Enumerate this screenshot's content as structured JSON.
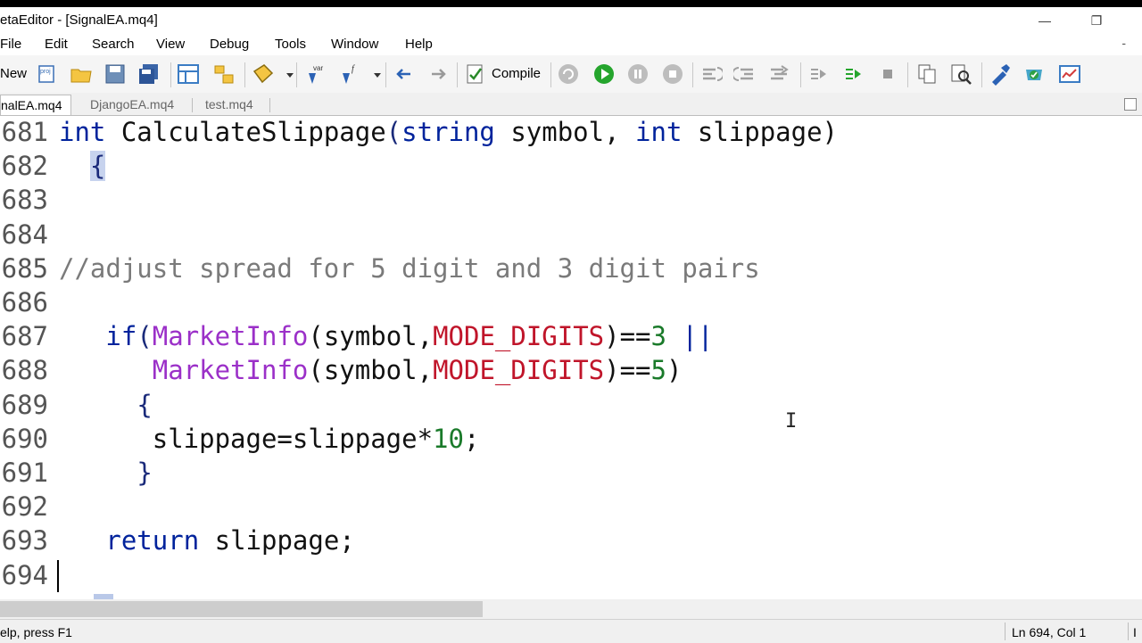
{
  "window": {
    "title": "etaEditor - [SignalEA.mq4]"
  },
  "menu": [
    "File",
    "Edit",
    "Search",
    "View",
    "Debug",
    "Tools",
    "Window",
    "Help"
  ],
  "toolbar": {
    "new_label": "New",
    "compile_label": "Compile",
    "var_label": "var"
  },
  "tabs": [
    "nalEA.mq4",
    "DjangoEA.mq4",
    "test.mq4"
  ],
  "editor": {
    "lines": [
      {
        "n": "681",
        "tokens": [
          {
            "t": "int ",
            "c": "kw"
          },
          {
            "t": "CalculateSlippage",
            "c": "fn"
          },
          {
            "t": "(",
            "c": "bk"
          },
          {
            "t": "string ",
            "c": "kw"
          },
          {
            "t": "symbol, ",
            "c": "fn"
          },
          {
            "t": "int ",
            "c": "kw"
          },
          {
            "t": "slippage)",
            "c": "fn"
          }
        ]
      },
      {
        "n": "682",
        "tokens": [
          {
            "t": "  ",
            "c": "fn"
          },
          {
            "t": "{",
            "c": "bk",
            "hl": true
          }
        ]
      },
      {
        "n": "683",
        "tokens": []
      },
      {
        "n": "684",
        "tokens": []
      },
      {
        "n": "685",
        "tokens": [
          {
            "t": "//adjust spread for 5 digit and 3 digit pairs",
            "c": "cm"
          }
        ]
      },
      {
        "n": "686",
        "tokens": []
      },
      {
        "n": "687",
        "tokens": [
          {
            "t": "   ",
            "c": "fn"
          },
          {
            "t": "if",
            "c": "kw"
          },
          {
            "t": "(",
            "c": "bk"
          },
          {
            "t": "MarketInfo",
            "c": "mf"
          },
          {
            "t": "(symbol,",
            "c": "fn"
          },
          {
            "t": "MODE_DIGITS",
            "c": "cst"
          },
          {
            "t": ")==",
            "c": "fn"
          },
          {
            "t": "3",
            "c": "num"
          },
          {
            "t": " ||",
            "c": "kw"
          }
        ]
      },
      {
        "n": "688",
        "tokens": [
          {
            "t": "      ",
            "c": "fn"
          },
          {
            "t": "MarketInfo",
            "c": "mf"
          },
          {
            "t": "(symbol,",
            "c": "fn"
          },
          {
            "t": "MODE_DIGITS",
            "c": "cst"
          },
          {
            "t": ")==",
            "c": "fn"
          },
          {
            "t": "5",
            "c": "num"
          },
          {
            "t": ")",
            "c": "fn"
          }
        ]
      },
      {
        "n": "689",
        "tokens": [
          {
            "t": "     ",
            "c": "fn"
          },
          {
            "t": "{",
            "c": "bk"
          }
        ]
      },
      {
        "n": "690",
        "tokens": [
          {
            "t": "      slippage=slippage*",
            "c": "fn"
          },
          {
            "t": "10",
            "c": "num"
          },
          {
            "t": ";",
            "c": "fn"
          }
        ]
      },
      {
        "n": "691",
        "tokens": [
          {
            "t": "     ",
            "c": "fn"
          },
          {
            "t": "}",
            "c": "bk"
          }
        ]
      },
      {
        "n": "692",
        "tokens": []
      },
      {
        "n": "693",
        "tokens": [
          {
            "t": "   ",
            "c": "fn"
          },
          {
            "t": "return ",
            "c": "kw"
          },
          {
            "t": "slippage;",
            "c": "fn"
          }
        ]
      },
      {
        "n": "694",
        "tokens": []
      }
    ]
  },
  "status": {
    "help": "elp, press F1",
    "position": "Ln 694, Col 1",
    "extra": "I"
  },
  "colors": {
    "keyword": "#00239c",
    "marketinfo": "#9b30c8",
    "constant": "#c0152a",
    "number": "#1a7a2a",
    "comment": "#7a7a7a"
  }
}
